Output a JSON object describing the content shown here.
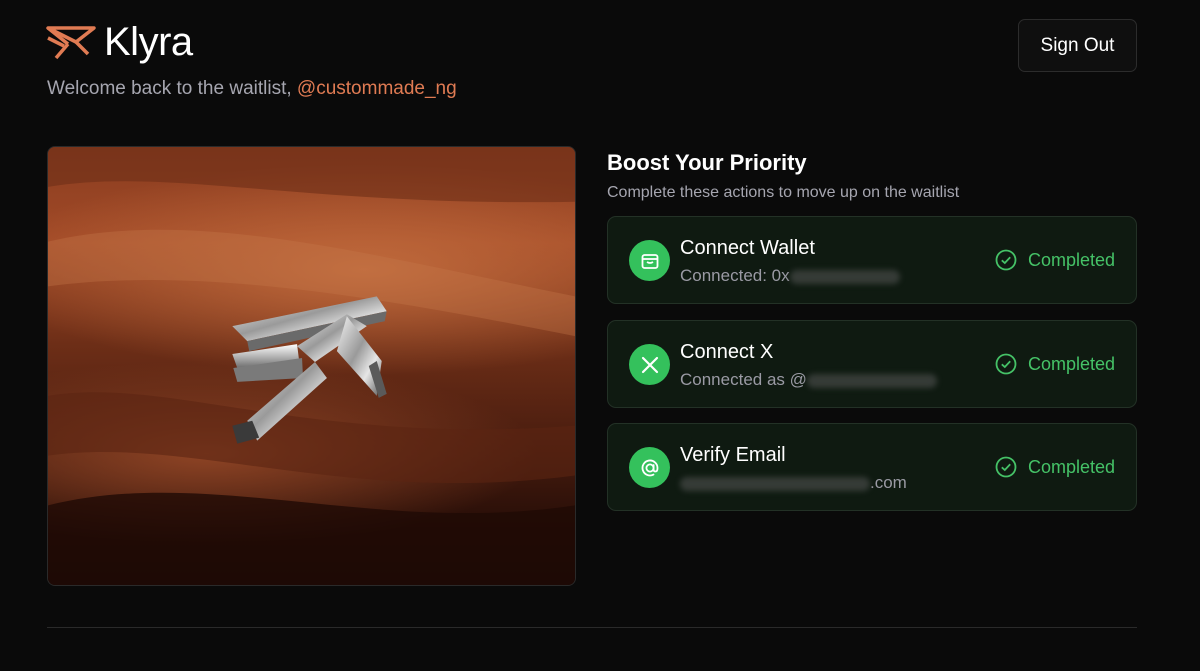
{
  "header": {
    "brand": "Klyra",
    "welcome_text": "Welcome back to the waitlist,",
    "handle": "@custommade_ng",
    "signout_label": "Sign Out"
  },
  "colors": {
    "accent": "#e07b53",
    "success": "#34c15c",
    "success_text": "#45c267",
    "background": "#0a0a0a"
  },
  "boost": {
    "title": "Boost Your Priority",
    "subtitle": "Complete these actions to move up on the waitlist",
    "tasks": [
      {
        "title": "Connect Wallet",
        "detail_prefix": "Connected: 0x",
        "detail_suffix": "",
        "status": "Completed",
        "icon": "wallet-icon"
      },
      {
        "title": "Connect X",
        "detail_prefix": "Connected as @",
        "detail_suffix": "",
        "status": "Completed",
        "icon": "x-logo-icon"
      },
      {
        "title": "Verify Email",
        "detail_prefix": "",
        "detail_suffix": ".com",
        "status": "Completed",
        "icon": "at-sign-icon"
      }
    ]
  }
}
